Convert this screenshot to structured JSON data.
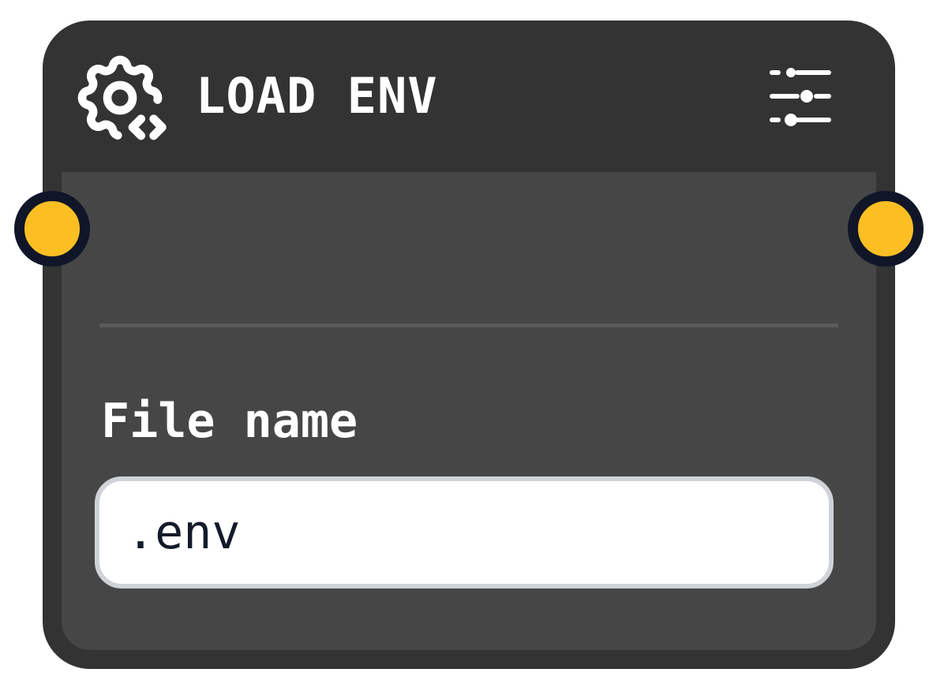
{
  "node": {
    "title": "LOAD ENV",
    "icon": "gear-code-icon",
    "settings_icon": "sliders-icon"
  },
  "fields": {
    "file_name": {
      "label": "File name",
      "value": ".env"
    }
  },
  "ports": {
    "input": "input-port",
    "output": "output-port"
  },
  "colors": {
    "node_bg": "#333333",
    "body_bg": "#464646",
    "port_fill": "#fbbf24",
    "port_border": "#101628",
    "input_border": "#cfd3d8",
    "text": "#ffffff",
    "input_text": "#141a2b"
  }
}
